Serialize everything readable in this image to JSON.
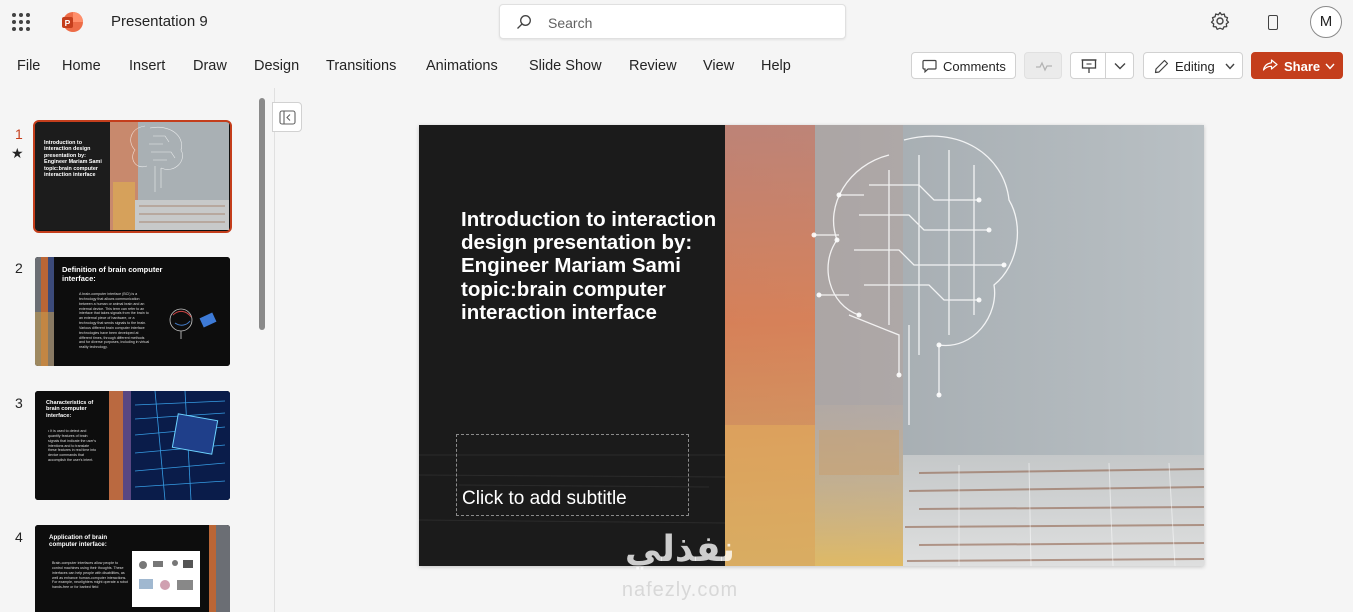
{
  "app": {
    "title": "Presentation 9",
    "logo_letter": "P",
    "user_initial": "M",
    "accent_color": "#c43e1c"
  },
  "search": {
    "placeholder": "Search"
  },
  "menu": [
    "File",
    "Home",
    "Insert",
    "Draw",
    "Design",
    "Transitions",
    "Animations",
    "Slide Show",
    "Review",
    "View",
    "Help"
  ],
  "toolbar": {
    "comments_label": "Comments",
    "editing_label": "Editing",
    "share_label": "Share"
  },
  "thumbnails": [
    {
      "number": "1",
      "title": "Introduction to interaction design presentation by: Engineer Mariam Sami topic:brain computer interaction interface",
      "body": ""
    },
    {
      "number": "2",
      "title": "Definition of brain computer interface:",
      "body": "A brain-computer interface (BCI) is a technology that allows communication between a human or animal brain and an external device. This term can refer to an interface that takes signals from the brain to an external piece of hardware, or a technology that sends signals to the brain. Various different brain computer interface technologies have been developed at different times, through different methods and for diverse purposes, including in virtual reality technology."
    },
    {
      "number": "3",
      "title": "Characteristics of brain computer interface:",
      "body": "• It is used to detect and quantify features of brain signals that indicate the user's intentions and to translate these features in real time into device commands that accomplish the user's intent."
    },
    {
      "number": "4",
      "title": "Application of brain computer interface:",
      "body": "Brain-computer interfaces allow people to control machines using their thoughts. These interfaces can help people with disabilities, as well as enhance human-computer interactions. For example, neurlighters might operate a robot hands-free or for barbed field"
    }
  ],
  "slide": {
    "title": "Introduction to interaction design presentation by: Engineer Mariam Sami topic:brain computer interaction interface",
    "subtitle_placeholder": "Click to add subtitle"
  },
  "watermark": {
    "arabic": "نفذلي",
    "latin": "nafezly.com"
  }
}
